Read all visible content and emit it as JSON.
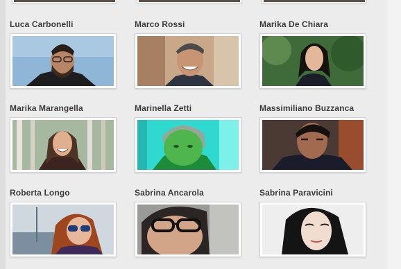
{
  "people": [
    {
      "name": "Luca Carbonelli"
    },
    {
      "name": "Marco Rossi"
    },
    {
      "name": "Marika De Chiara"
    },
    {
      "name": "Marika Marangella"
    },
    {
      "name": "Marinella Zetti"
    },
    {
      "name": "Massimiliano Buzzanca"
    },
    {
      "name": "Roberta Longo"
    },
    {
      "name": "Sabrina Ancarola"
    },
    {
      "name": "Sabrina Paravicini"
    }
  ]
}
